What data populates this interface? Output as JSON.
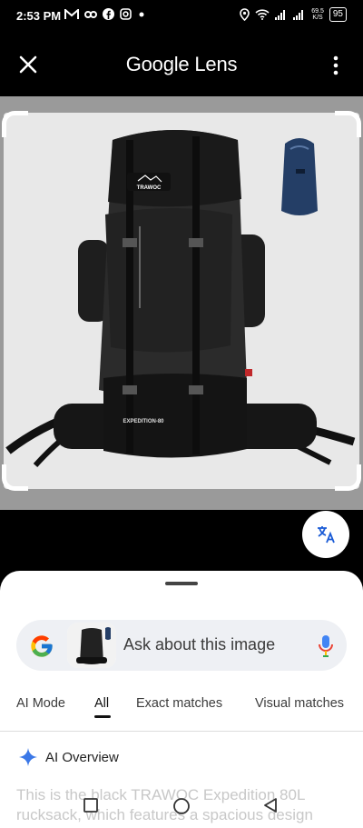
{
  "status": {
    "time": "2:53 PM",
    "net_speed_value": "69.5",
    "net_speed_unit": "K/S",
    "battery": "95"
  },
  "app_bar": {
    "title": "Google Lens"
  },
  "search": {
    "placeholder": "Ask about this image"
  },
  "tabs": [
    "AI Mode",
    "All",
    "Exact matches",
    "Visual matches"
  ],
  "ai_overview": {
    "label": "AI Overview",
    "text": "This is the black TRAWOC Expedition 80L rucksack, which features a spacious design"
  },
  "product_image": {
    "brand_label": "TRAWOC",
    "model_label": "EXPEDITION-80"
  }
}
